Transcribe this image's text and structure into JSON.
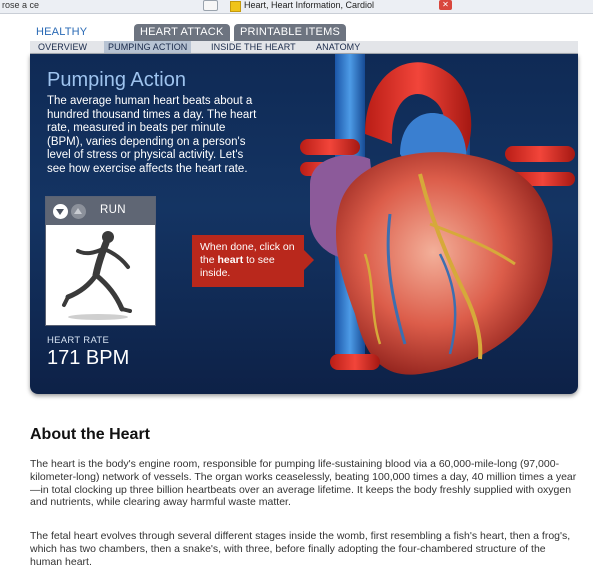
{
  "browser": {
    "left_fragment": "rose a ce",
    "tab_title": "Heart, Heart Information, Cardiol",
    "close_symbol": "✕"
  },
  "tabs": {
    "top": [
      {
        "label": "HEALTHY HEART",
        "active": true
      },
      {
        "label": "HEART ATTACK",
        "active": false
      },
      {
        "label": "PRINTABLE ITEMS",
        "active": false
      }
    ],
    "sub": [
      {
        "label": "OVERVIEW",
        "active": false
      },
      {
        "label": "PUMPING ACTION",
        "active": true
      },
      {
        "label": "INSIDE THE HEART",
        "active": false
      },
      {
        "label": "ANATOMY",
        "active": false
      }
    ]
  },
  "panel": {
    "title": "Pumping Action",
    "body": "The average human heart beats about a hundred thousand times a day. The heart rate, measured in beats per minute (BPM), varies depending on a person's level of stress or physical activity. Let's see how exercise affects the heart rate.",
    "activity": {
      "label": "RUN",
      "down_icon": "chevron-down-icon",
      "up_icon": "chevron-up-icon"
    },
    "heart_rate_label": "HEART RATE",
    "heart_rate_value": "171 BPM",
    "callout_prefix": "When done, click on the ",
    "callout_bold": "heart",
    "callout_suffix": " to see inside."
  },
  "article": {
    "title": "About the Heart",
    "paragraphs": [
      "The heart is the body's engine room, responsible for pumping life-sustaining blood via a 60,000-mile-long (97,000-kilometer-long) network of vessels. The organ works ceaselessly, beating 100,000 times a day, 40 million times a year—in total clocking up three billion heartbeats over an average lifetime. It keeps the body freshly supplied with oxygen and nutrients, while clearing away harmful waste matter.",
      "The fetal heart evolves through several different stages inside the womb, first resembling a fish's heart, then a frog's, which has two chambers, then a snake's, with three, before finally adopting the four-chambered structure of the human heart."
    ]
  },
  "colors": {
    "panel_bg": "#143463",
    "title_blue": "#9ec3ee",
    "callout_red": "#b9281c",
    "active_tab_text": "#2a6ab5"
  }
}
